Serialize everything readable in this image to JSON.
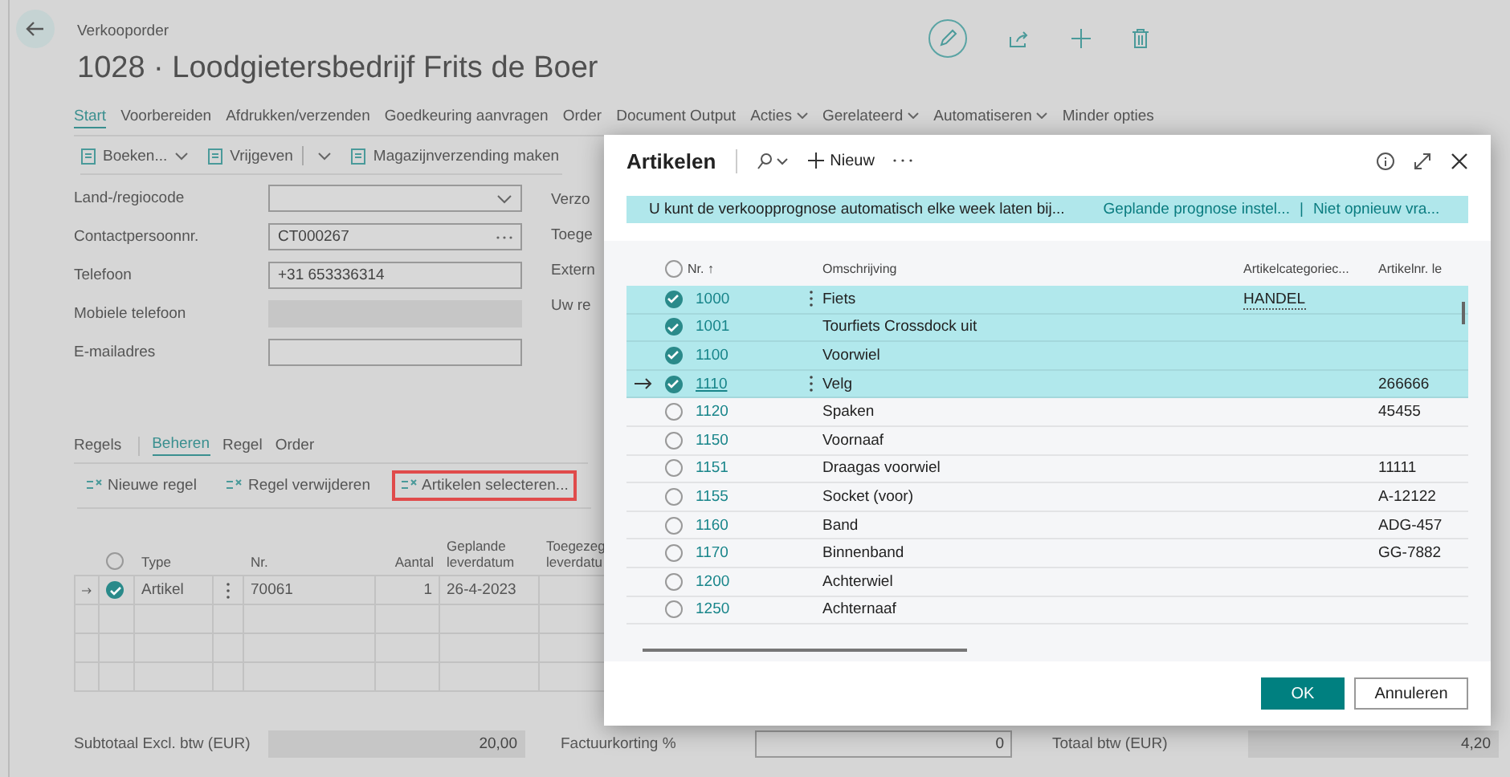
{
  "page": {
    "breadcrumb": "Verkooporder",
    "title": "1028 · Loodgietersbedrijf Frits de Boer",
    "tabs": [
      {
        "label": "Start",
        "selected": true,
        "dropdown": false
      },
      {
        "label": "Voorbereiden",
        "selected": false,
        "dropdown": false
      },
      {
        "label": "Afdrukken/verzenden",
        "selected": false,
        "dropdown": false
      },
      {
        "label": "Goedkeuring aanvragen",
        "selected": false,
        "dropdown": false
      },
      {
        "label": "Order",
        "selected": false,
        "dropdown": false
      },
      {
        "label": "Document Output",
        "selected": false,
        "dropdown": false
      },
      {
        "label": "Acties",
        "selected": false,
        "dropdown": true
      },
      {
        "label": "Gerelateerd",
        "selected": false,
        "dropdown": true
      },
      {
        "label": "Automatiseren",
        "selected": false,
        "dropdown": true
      },
      {
        "label": "Minder opties",
        "selected": false,
        "dropdown": false
      }
    ],
    "actions": [
      {
        "label": "Boeken...",
        "split": false,
        "dropdown": true
      },
      {
        "label": "Vrijgeven",
        "split": true,
        "dropdown": true
      },
      {
        "label": "Magazijnverzending maken",
        "split": false,
        "dropdown": false
      }
    ],
    "fields": [
      {
        "label": "Land-/regiocode",
        "kind": "dropdown",
        "disabled": false
      },
      {
        "label": "Contactpersoonnr.",
        "value": "CT000267",
        "kind": "lookup",
        "disabled": false
      },
      {
        "label": "Telefoon",
        "value": "+31 653336314",
        "kind": "text",
        "disabled": false
      },
      {
        "label": "Mobiele telefoon",
        "kind": "text",
        "disabled": true
      },
      {
        "label": "E-mailadres",
        "kind": "text",
        "disabled": false
      }
    ],
    "fields_right": [
      "Verzo",
      "Toege",
      "Extern",
      "Uw re"
    ],
    "lines": {
      "label": "Regels",
      "tabs": [
        {
          "label": "Beheren",
          "selected": true
        },
        {
          "label": "Regel",
          "selected": false
        },
        {
          "label": "Order",
          "selected": false
        }
      ],
      "actions": [
        {
          "label": "Nieuwe regel",
          "highlighted": false
        },
        {
          "label": "Regel verwijderen",
          "highlighted": false
        },
        {
          "label": "Artikelen selecteren...",
          "highlighted": true
        }
      ],
      "all_selected": false,
      "columns": [
        "Type",
        "Nr.",
        "Aantal",
        "Geplande leverdatum",
        "Toegezeg leverdatu"
      ],
      "rows": [
        {
          "current": true,
          "selected": true,
          "type": "Artikel",
          "no": "70061",
          "quantity": "1",
          "planned": "26-4-2023"
        }
      ]
    },
    "totals": [
      {
        "label": "Subtotaal Excl. btw (EUR)",
        "value": "20,00",
        "disabled": true
      },
      {
        "label": "Factuurkorting %",
        "value": "0",
        "disabled": false
      },
      {
        "label": "Totaal btw (EUR)",
        "value": "4,20",
        "disabled": true
      }
    ]
  },
  "dialog": {
    "title": "Artikelen",
    "new_label": "Nieuw",
    "notification": {
      "message": "U kunt de verkoopprognose automatisch elke week laten bij...",
      "link_1": "Geplande prognose instel...",
      "separator": "|",
      "link_2": "Niet opnieuw vra..."
    },
    "all_selected": false,
    "columns": [
      "Nr. ↑",
      "Omschrijving",
      "Artikelcategoriec...",
      "Artikelnr. le"
    ],
    "rows": [
      {
        "no": "1000",
        "description": "Fiets",
        "category": "HANDEL",
        "selected": true,
        "current": false,
        "menu": true
      },
      {
        "no": "1001",
        "description": "Tourfiets Crossdock uit",
        "selected": true,
        "current": false,
        "menu": false
      },
      {
        "no": "1100",
        "description": "Voorwiel",
        "selected": true,
        "current": false,
        "menu": false
      },
      {
        "no": "1110",
        "description": "Velg",
        "item_no": "266666",
        "selected": true,
        "current": true,
        "menu": true
      },
      {
        "no": "1120",
        "description": "Spaken",
        "item_no": "45455",
        "selected": false,
        "current": false,
        "menu": false
      },
      {
        "no": "1150",
        "description": "Voornaaf",
        "selected": false,
        "current": false,
        "menu": false
      },
      {
        "no": "1151",
        "description": "Draagas voorwiel",
        "item_no": "11111",
        "selected": false,
        "current": false,
        "menu": false
      },
      {
        "no": "1155",
        "description": "Socket (voor)",
        "item_no": "A-12122",
        "selected": false,
        "current": false,
        "menu": false
      },
      {
        "no": "1160",
        "description": "Band",
        "item_no": "ADG-457",
        "selected": false,
        "current": false,
        "menu": false
      },
      {
        "no": "1170",
        "description": "Binnenband",
        "item_no": "GG-7882",
        "selected": false,
        "current": false,
        "menu": false
      },
      {
        "no": "1200",
        "description": "Achterwiel",
        "selected": false,
        "current": false,
        "menu": false
      },
      {
        "no": "1250",
        "description": "Achternaaf",
        "selected": false,
        "current": false,
        "menu": false
      }
    ],
    "buttons": [
      {
        "label": "OK",
        "kind": "primary"
      },
      {
        "label": "Annuleren",
        "kind": "secondary"
      }
    ]
  }
}
